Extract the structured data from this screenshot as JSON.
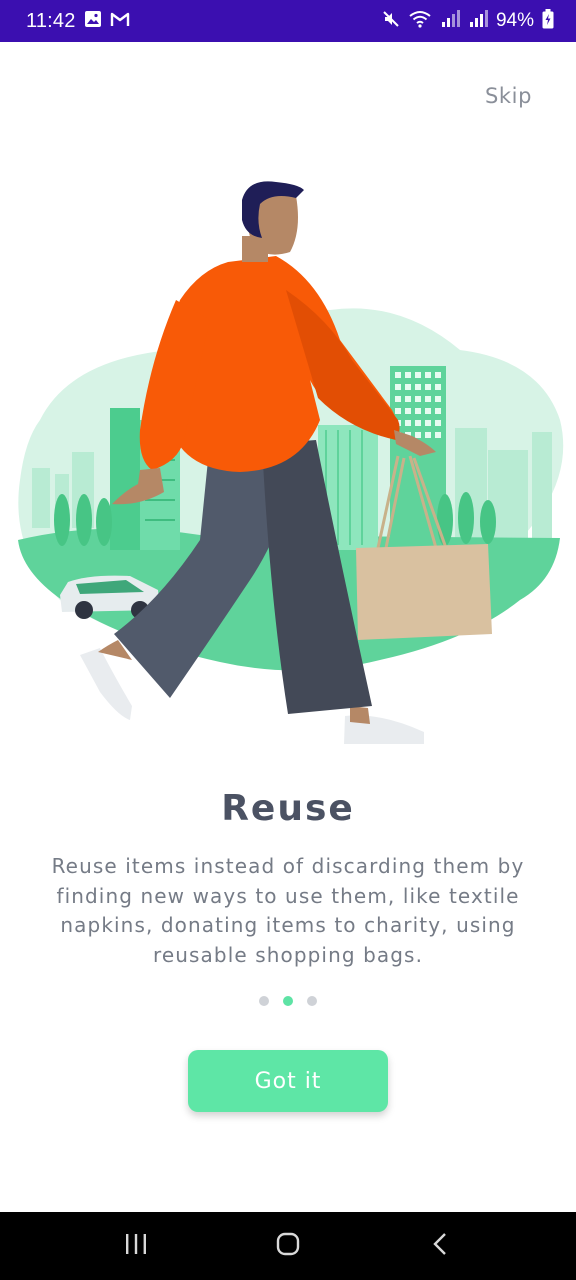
{
  "status_bar": {
    "time": "11:42",
    "battery": "94%",
    "icons": [
      "gallery-icon",
      "gmail-icon",
      "mute-icon",
      "wifi-icon",
      "signal-icon",
      "signal-icon",
      "battery-icon"
    ]
  },
  "header": {
    "skip_label": "Skip"
  },
  "slide": {
    "title": "Reuse",
    "description": "Reuse items instead of discarding them by finding new ways to use them, like textile napkins, donating items to charity, using reusable shopping bags.",
    "page_indicator": {
      "total": 3,
      "active_index": 1
    }
  },
  "actions": {
    "got_it_label": "Got it"
  },
  "nav_bar": {
    "buttons": [
      "recents-icon",
      "home-icon",
      "back-icon"
    ]
  },
  "colors": {
    "status_bar": "#3b0fb0",
    "accent": "#5ee6a6",
    "title": "#4b5263",
    "body_text": "#757b86"
  }
}
